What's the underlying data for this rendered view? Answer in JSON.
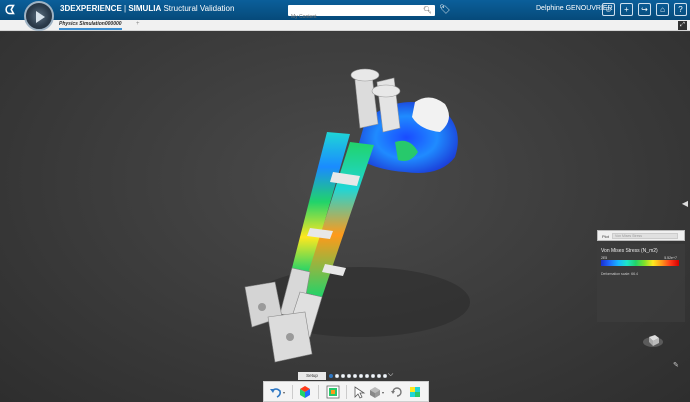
{
  "header": {
    "app_brand": "3DEXPERIENCE",
    "app_separator": " | ",
    "app_product": "SIMULIA",
    "app_name": " Structural Validation",
    "search_placeholder": "My Content",
    "user_name": "Delphine GENOUVRIER",
    "colors": {
      "bar": "#064a7a",
      "accent": "#3a8fd3"
    }
  },
  "tabs": [
    {
      "label": "Physics Simulation000000"
    }
  ],
  "legend": {
    "plot_label": "Plot",
    "plot_select_value": "Von Mises Stress",
    "title": "Von Mises Stress (N_m2)",
    "min_value": "2E5",
    "max_value": "5.52e+7",
    "note": "Deformation scale: 66.4"
  },
  "toolbar": {
    "stage_label": "Setup",
    "stage_count": 10,
    "active_stage": 0,
    "icons": [
      "undo-icon",
      "color-cube-icon",
      "display-icon",
      "pointer-icon",
      "box-icon",
      "rotate-icon",
      "mesh-icon"
    ]
  }
}
